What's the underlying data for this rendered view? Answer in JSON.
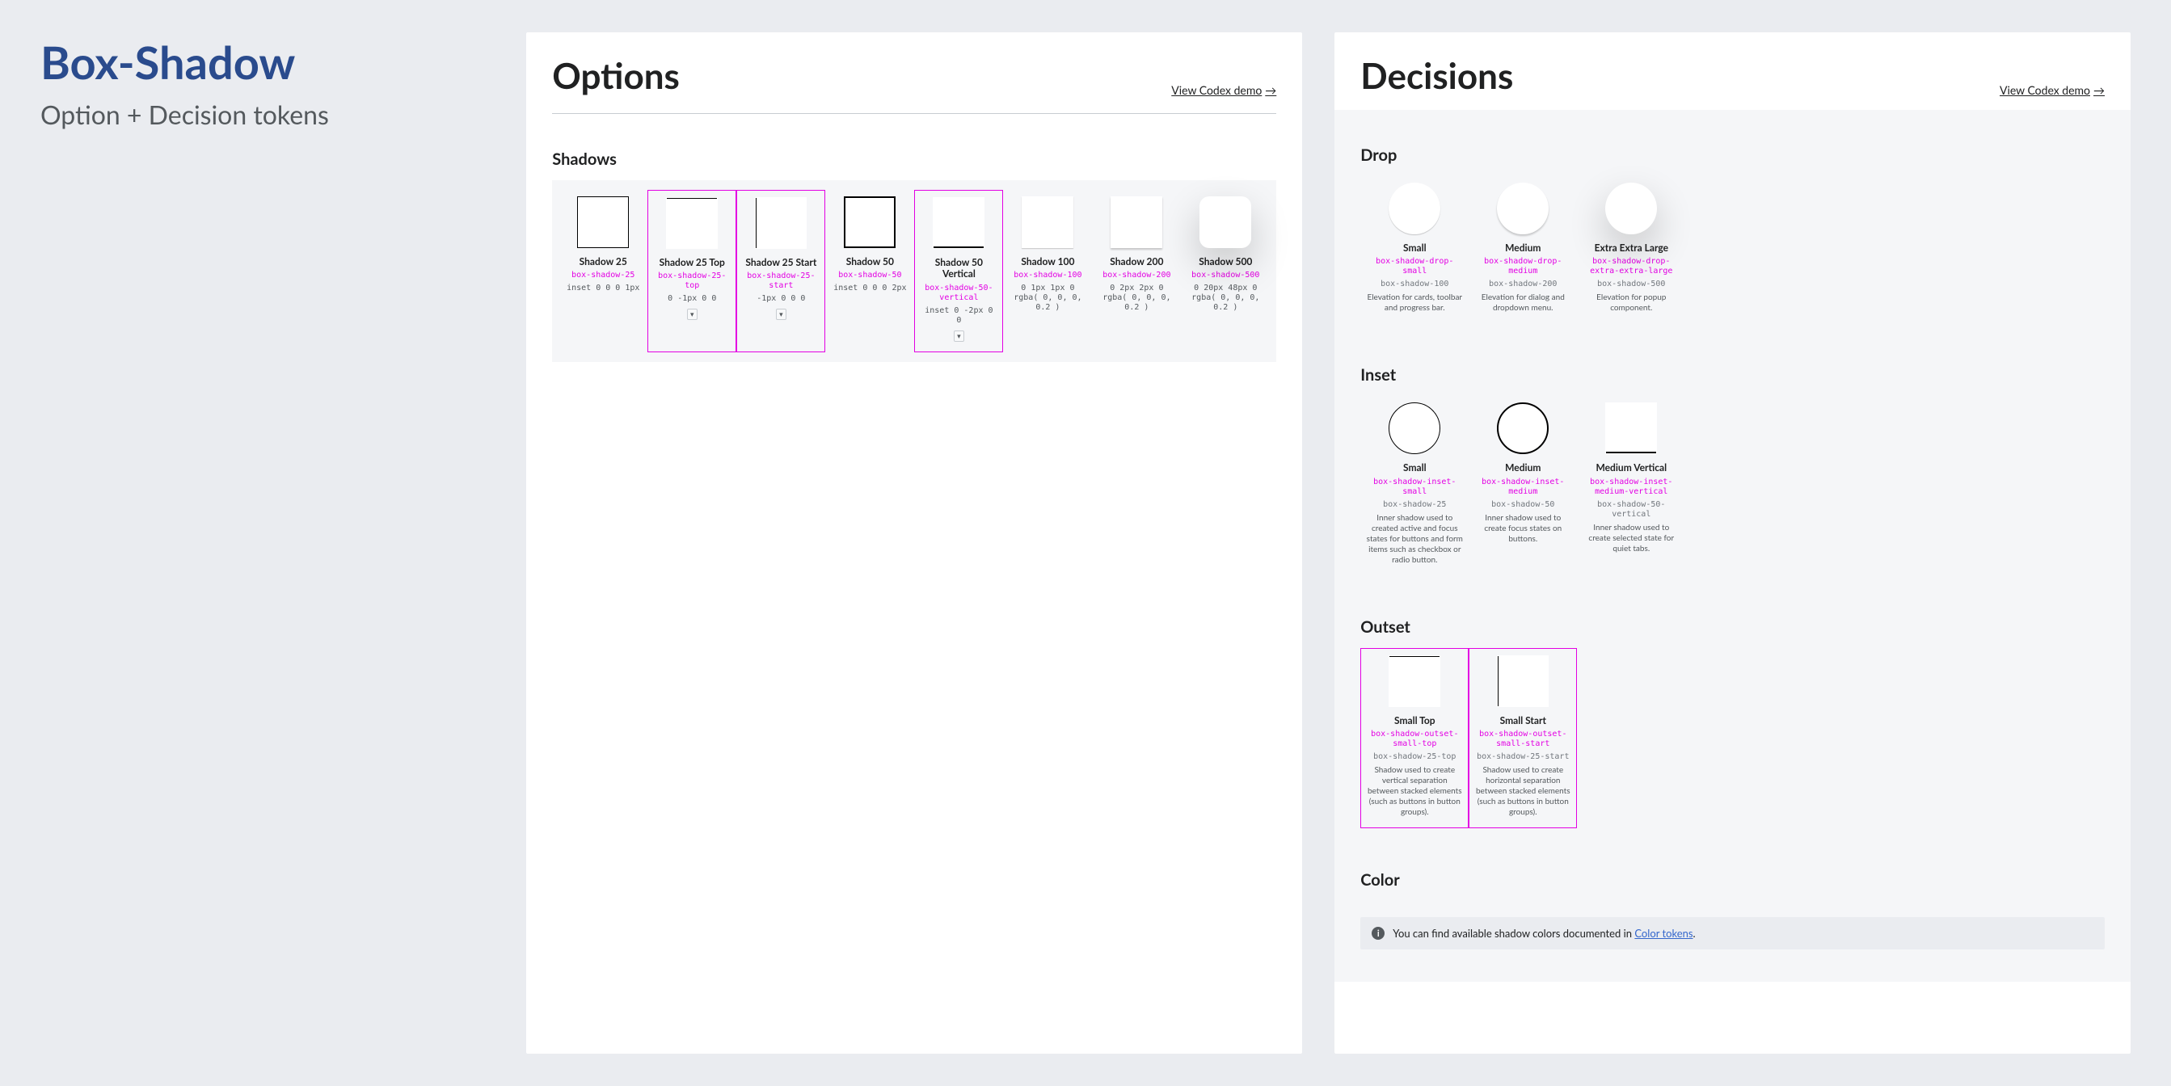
{
  "sidebar": {
    "title": "Box-Shadow",
    "subtitle": "Option + Decision tokens"
  },
  "options": {
    "heading": "Options",
    "codex_link": "View Codex demo",
    "shadows": {
      "label": "Shadows",
      "items": [
        {
          "name": "Shadow 25",
          "token": "box-shadow-25",
          "value": "inset 0 0 0 1px",
          "highlight": false
        },
        {
          "name": "Shadow 25 Top",
          "token": "box-shadow-25-top",
          "value": "0 -1px 0 0",
          "highlight": true
        },
        {
          "name": "Shadow 25 Start",
          "token": "box-shadow-25-start",
          "value": "-1px 0 0 0",
          "highlight": true
        },
        {
          "name": "Shadow 50",
          "token": "box-shadow-50",
          "value": "inset 0 0 0 2px",
          "highlight": false
        },
        {
          "name": "Shadow 50 Vertical",
          "token": "box-shadow-50-vertical",
          "value": "inset 0 -2px 0 0",
          "highlight": true
        },
        {
          "name": "Shadow 100",
          "token": "box-shadow-100",
          "value": "0 1px 1px 0 rgba( 0, 0, 0, 0.2 )",
          "highlight": false
        },
        {
          "name": "Shadow 200",
          "token": "box-shadow-200",
          "value": "0 2px 2px 0 rgba( 0, 0, 0, 0.2 )",
          "highlight": false
        },
        {
          "name": "Shadow 500",
          "token": "box-shadow-500",
          "value": "0 20px 48px 0 rgba( 0, 0, 0, 0.2 )",
          "highlight": false
        }
      ]
    }
  },
  "decisions": {
    "heading": "Decisions",
    "codex_link": "View Codex demo",
    "drop": {
      "label": "Drop",
      "items": [
        {
          "name": "Small",
          "token": "box-shadow-drop-small",
          "alias": "box-shadow-100",
          "desc": "Elevation for cards, toolbar and progress bar."
        },
        {
          "name": "Medium",
          "token": "box-shadow-drop-medium",
          "alias": "box-shadow-200",
          "desc": "Elevation for dialog and dropdown menu."
        },
        {
          "name": "Extra Extra Large",
          "token": "box-shadow-drop-extra-extra-large",
          "alias": "box-shadow-500",
          "desc": "Elevation for popup component."
        }
      ]
    },
    "inset": {
      "label": "Inset",
      "items": [
        {
          "name": "Small",
          "token": "box-shadow-inset-small",
          "alias": "box-shadow-25",
          "desc": "Inner shadow used to created active and focus states for buttons and form items such as checkbox or radio button."
        },
        {
          "name": "Medium",
          "token": "box-shadow-inset-medium",
          "alias": "box-shadow-50",
          "desc": "Inner shadow used to create focus states on buttons."
        },
        {
          "name": "Medium Vertical",
          "token": "box-shadow-inset-medium-vertical",
          "alias": "box-shadow-50-vertical",
          "desc": "Inner shadow used to create selected state for quiet tabs."
        }
      ]
    },
    "outset": {
      "label": "Outset",
      "items": [
        {
          "name": "Small Top",
          "token": "box-shadow-outset-small-top",
          "alias": "box-shadow-25-top",
          "desc": "Shadow used to create vertical separation between stacked elements (such as buttons in button groups)."
        },
        {
          "name": "Small Start",
          "token": "box-shadow-outset-small-start",
          "alias": "box-shadow-25-start",
          "desc": "Shadow used to create horizontal separation between stacked elements (such as buttons in button groups)."
        }
      ]
    },
    "color": {
      "label": "Color",
      "info_prefix": "You can find available shadow colors documented in ",
      "info_link": "Color tokens"
    }
  }
}
